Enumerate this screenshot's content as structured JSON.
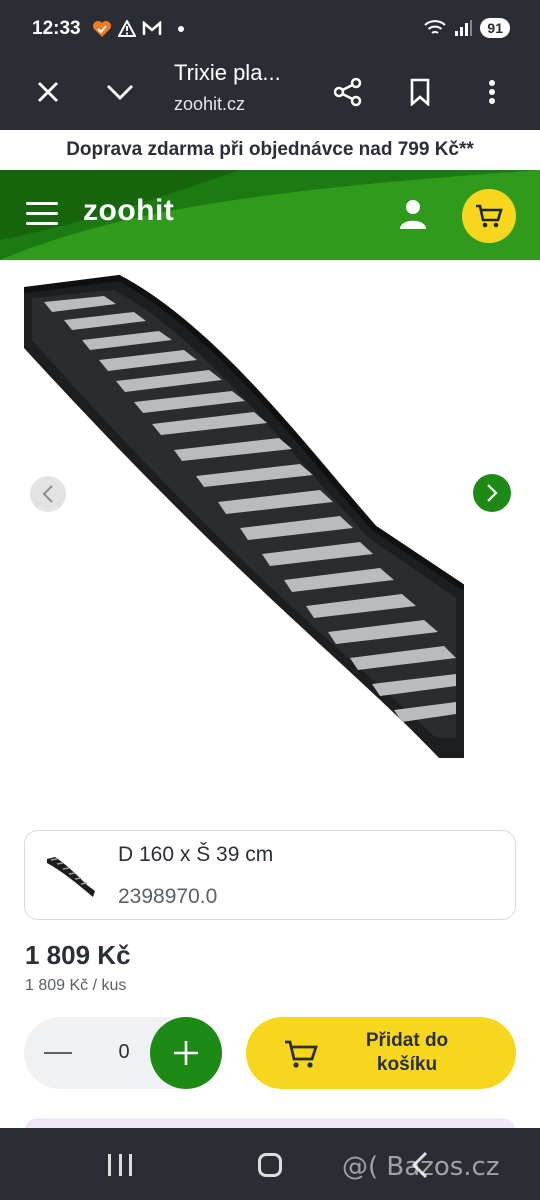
{
  "status_bar": {
    "time": "12:33",
    "battery": "91",
    "icons": [
      "heart-icon",
      "warning-icon",
      "mail-icon",
      "wifi-icon",
      "signal-icon"
    ]
  },
  "browser": {
    "title": "Trixie pla...",
    "url": "zoohit.cz",
    "icons": [
      "close-icon",
      "chevron-down-icon",
      "share-icon",
      "bookmark-icon",
      "more-icon"
    ]
  },
  "promo": {
    "text": "Doprava zdarma při objednávce nad 799 Kč**"
  },
  "header": {
    "logo": "zoohit",
    "brand_color": "#1c7a12",
    "accent_color": "#f7d61e"
  },
  "product": {
    "variant_name": "D 160 x Š 39 cm",
    "variant_code": "2398970.0",
    "price": "1 809 Kč",
    "unit_price": "1 809 Kč / kus",
    "quantity": "0",
    "add_to_cart_label": "Přidat do košíku"
  },
  "watermark": "@( Bazos.cz"
}
